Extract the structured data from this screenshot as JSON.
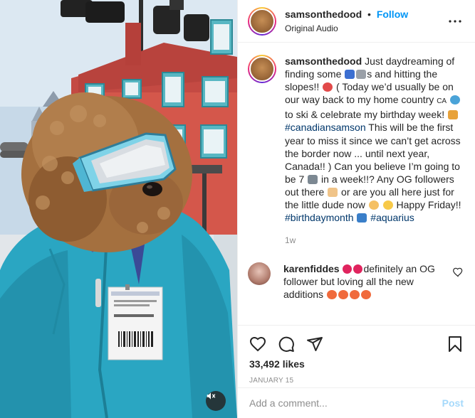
{
  "header": {
    "username": "samsonthedood",
    "separator": "•",
    "follow_label": "Follow",
    "audio_label": "Original Audio",
    "more_icon": "more-horizontal-icon"
  },
  "caption": {
    "username": "samsonthedood",
    "t1": "Just daydreaming of finding some ",
    "t2": "s and hitting the slopes!! ",
    "t3": " ( Today we’d usually be on our way back to my home country ",
    "country_code": "CA",
    "t4": " to ski & celebrate my birthday week! ",
    "tag1": "#canadiansamson",
    "t5": " This will be the first year to miss it since we can’t get across the border now ... until next year, Canada!! ) Can you believe I’m going to be 7 ",
    "t6": " in a week!!? Any OG followers out there ",
    "t7": " or are you all here just for the little dude now ",
    "t8": " Happy Friday!! ",
    "tag2": "#birthdaymonth",
    "tag3": "#aquarius",
    "time_ago": "1w"
  },
  "comment": {
    "username": "karenfiddes",
    "text": "definitely an OG follower but loving all the new additions"
  },
  "actions": {
    "likes": "33,492 likes",
    "date": "JANUARY 15",
    "icons": [
      "heart-icon",
      "comment-icon",
      "share-icon",
      "bookmark-icon"
    ]
  },
  "add_comment": {
    "placeholder": "Add a comment...",
    "post_label": "Post"
  },
  "colors": {
    "accent": "#0095f6",
    "hashtag": "#00376b",
    "jacket": "#2aa6c2",
    "goggles": "#7fd3e8"
  }
}
